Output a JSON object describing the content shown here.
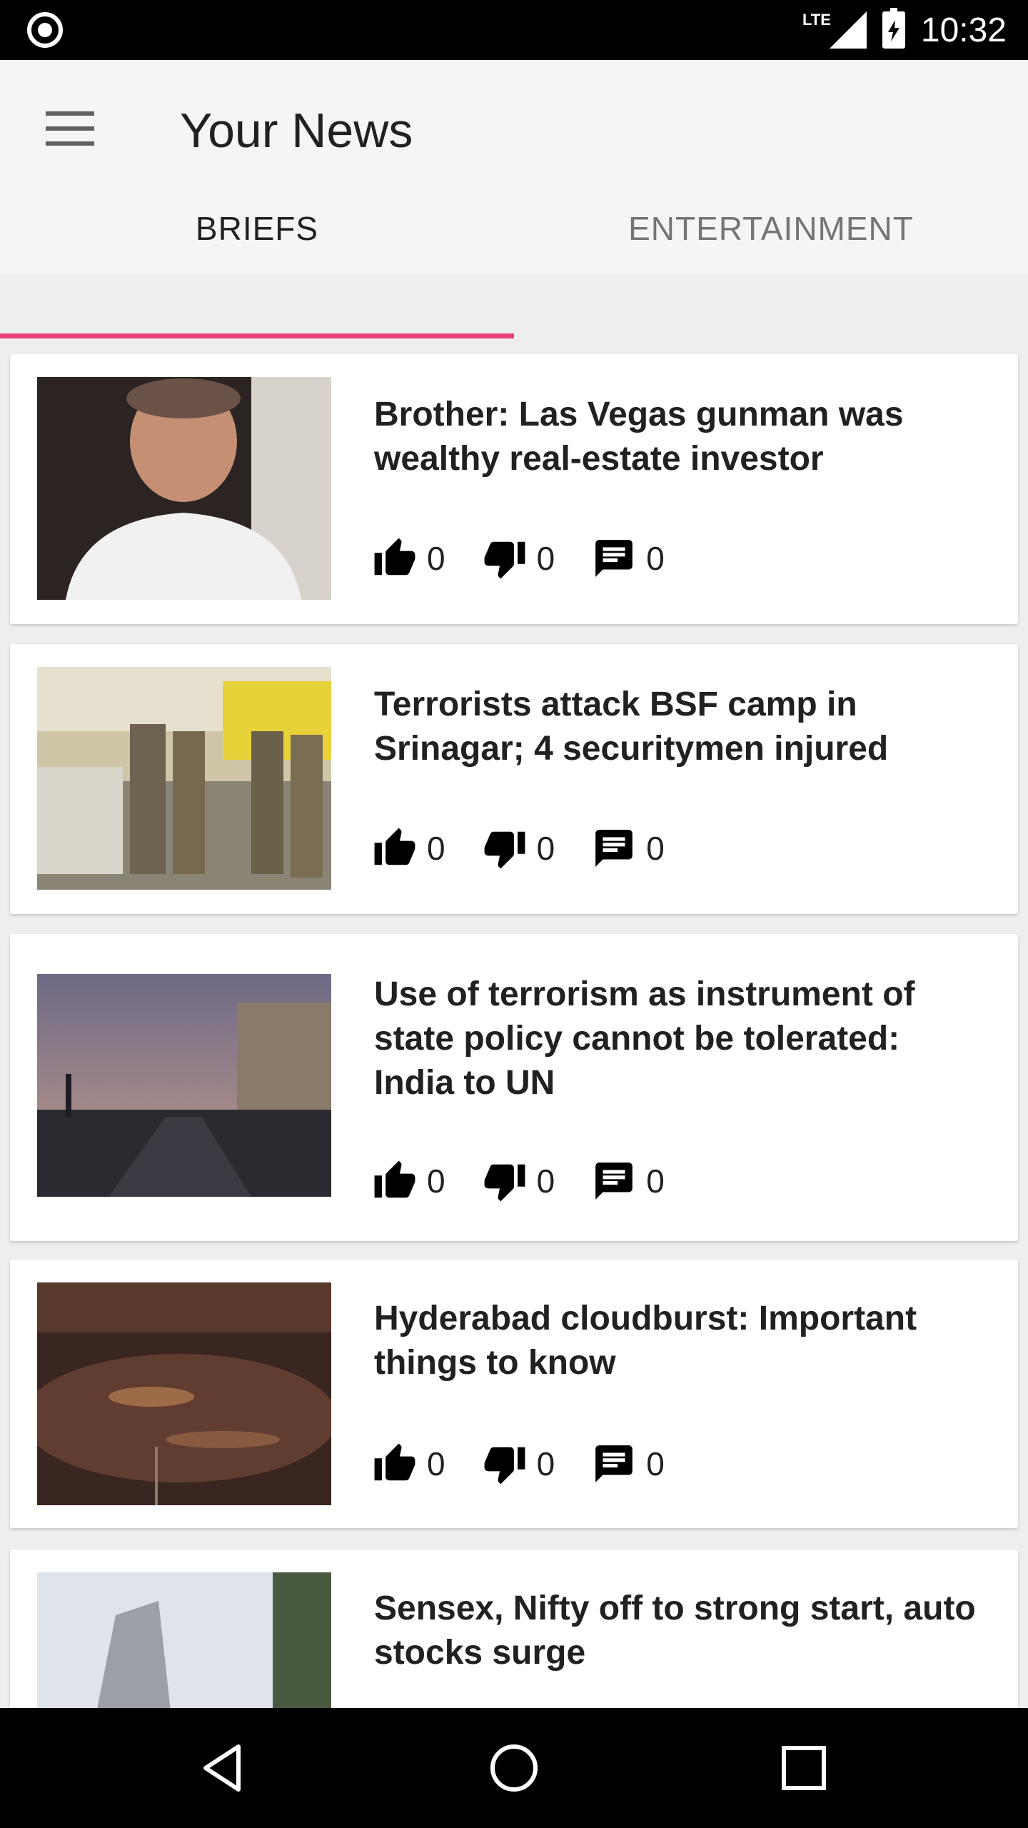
{
  "status_bar": {
    "network_label": "LTE",
    "time": "10:32"
  },
  "header": {
    "title": "Your News",
    "menu_icon": "hamburger-menu-icon"
  },
  "tabs": [
    {
      "label": "BRIEFS",
      "active": true
    },
    {
      "label": "ENTERTAINMENT",
      "active": false
    }
  ],
  "accent_color": "#ec407a",
  "articles": [
    {
      "headline": "Brother: Las Vegas gunman was wealthy real-estate investor",
      "likes": "0",
      "dislikes": "0",
      "comments": "0"
    },
    {
      "headline": "Terrorists attack BSF camp in Srinagar; 4 securitymen injured",
      "likes": "0",
      "dislikes": "0",
      "comments": "0"
    },
    {
      "headline": "Use of terrorism as instrument of state policy cannot be tolerated: India to UN",
      "likes": "0",
      "dislikes": "0",
      "comments": "0"
    },
    {
      "headline": "Hyderabad cloudburst: Important things to know",
      "likes": "0",
      "dislikes": "0",
      "comments": "0"
    },
    {
      "headline": "Sensex, Nifty off to strong start, auto stocks surge"
    }
  ],
  "nav_bar": {
    "icons": [
      "back-icon",
      "home-icon",
      "recents-icon"
    ]
  }
}
